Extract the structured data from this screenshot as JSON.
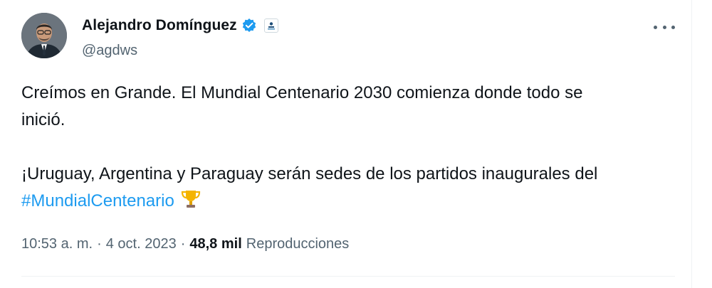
{
  "author": {
    "name": "Alejandro Domínguez",
    "handle": "@agdws",
    "verified_color": "#1d9bf0"
  },
  "tweet": {
    "line1": "Creímos en Grande. El Mundial Centenario 2030 comienza donde todo se",
    "line2": "inició.",
    "line3": "¡Uruguay, Argentina y Paraguay serán sedes de los partidos inaugurales del",
    "hashtag": "#MundialCentenario",
    "emoji_icon": "trophy-icon"
  },
  "meta": {
    "time": "10:53 a. m.",
    "separator": "·",
    "date": "4 oct. 2023",
    "views_count": "48,8 mil",
    "views_label": "Reproducciones"
  },
  "colors": {
    "link": "#1d9bf0",
    "secondary_text": "#536471",
    "primary_text": "#0f1419"
  }
}
